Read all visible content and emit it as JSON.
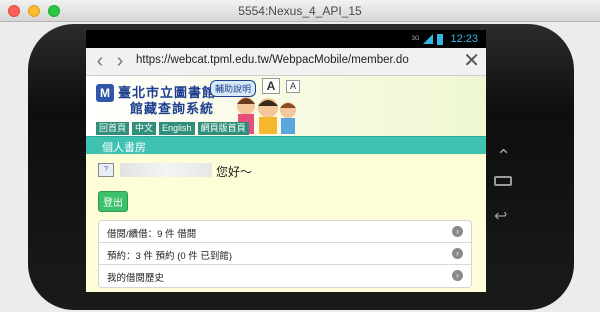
{
  "window": {
    "title": "5554:Nexus_4_API_15"
  },
  "statusbar": {
    "network": "3G",
    "time": "12:23"
  },
  "browser": {
    "url": "https://webcat.tpml.edu.tw/WebpacMobile/member.do",
    "back_icon": "chevron-left-icon",
    "forward_icon": "chevron-right-icon",
    "clear_icon": "close-icon"
  },
  "header": {
    "logo": "library-logo-icon",
    "name": "臺北市立圖書館",
    "subtitle": "館藏查詢系統",
    "help": "輔助說明",
    "font_large": "A",
    "font_small": "A",
    "nav": [
      "回首頁",
      "中文",
      "English",
      "網頁版首頁"
    ]
  },
  "section": {
    "title": "個人書房"
  },
  "greeting": {
    "suffix": "您好～"
  },
  "logout": "登出",
  "menu": [
    {
      "label": "借閱/續借：9 件 借閱"
    },
    {
      "label": "預約：3 件 預約 (0 件 已到館)"
    },
    {
      "label": "我的借閱歷史"
    }
  ],
  "colors": {
    "section_bar": "#3fc2b2",
    "logout": "#3cc06a",
    "page_bg": "#fdfdd8"
  }
}
